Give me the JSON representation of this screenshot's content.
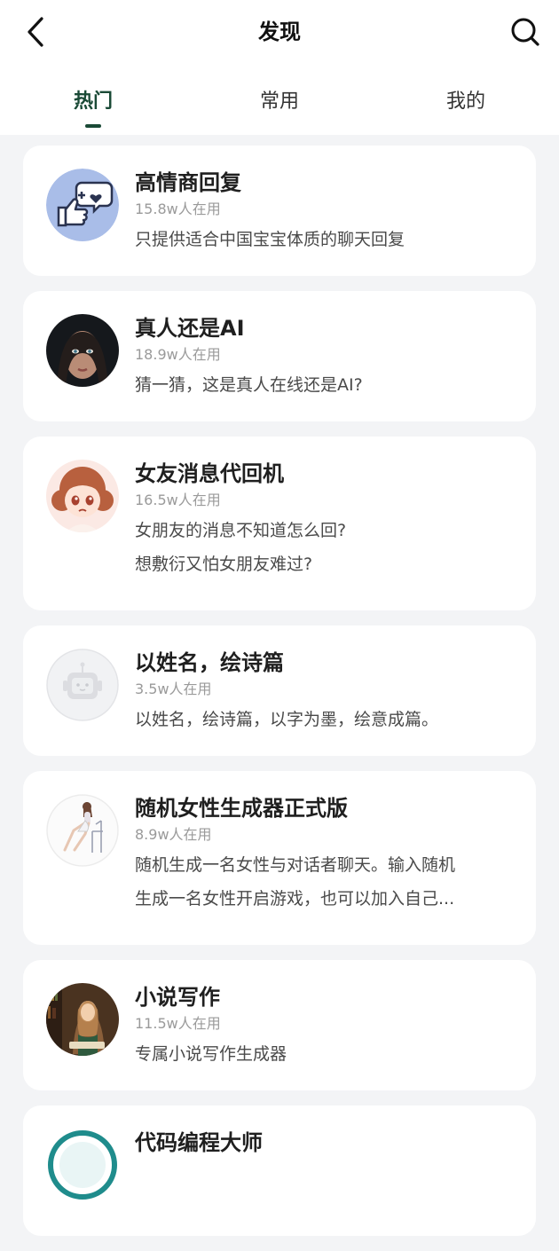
{
  "header": {
    "title": "发现",
    "back_icon": "back-arrow-icon",
    "search_icon": "search-icon"
  },
  "tabs": [
    {
      "label": "热门",
      "active": true
    },
    {
      "label": "常用",
      "active": false
    },
    {
      "label": "我的",
      "active": false
    }
  ],
  "colors": {
    "accent": "#1a4a36",
    "background": "#f3f4f6",
    "card": "#ffffff",
    "muted_text": "#9a9a9a"
  },
  "apps": [
    {
      "title": "高情商回复",
      "users": "15.8w人在用",
      "desc_lines": [
        "只提供适合中国宝宝体质的聊天回复"
      ],
      "avatar": "thumbs-up-heart-chat-icon"
    },
    {
      "title": "真人还是AI",
      "users": "18.9w人在用",
      "desc_lines": [
        "猜一猜，这是真人在线还是AI?"
      ],
      "avatar": "portrait-photo"
    },
    {
      "title": "女友消息代回机",
      "users": "16.5w人在用",
      "desc_lines": [
        "女朋友的消息不知道怎么回?",
        "想敷衍又怕女朋友难过?"
      ],
      "avatar": "anime-girl-avatar"
    },
    {
      "title": "以姓名，绘诗篇",
      "users": "3.5w人在用",
      "desc_lines": [
        "以姓名，绘诗篇，以字为墨，绘意成篇。"
      ],
      "avatar": "robot-placeholder-icon"
    },
    {
      "title": "随机女性生成器正式版",
      "users": "8.9w人在用",
      "desc_lines": [
        "随机生成一名女性与对话者聊天。输入随机",
        "生成一名女性开启游戏，也可以加入自己..."
      ],
      "avatar": "sitting-girl-sketch"
    },
    {
      "title": "小说写作",
      "users": "11.5w人在用",
      "desc_lines": [
        "专属小说写作生成器"
      ],
      "avatar": "woman-reading-painting"
    },
    {
      "title": "代码编程大师",
      "users": "",
      "desc_lines": [],
      "avatar": "teal-circle-icon"
    }
  ]
}
